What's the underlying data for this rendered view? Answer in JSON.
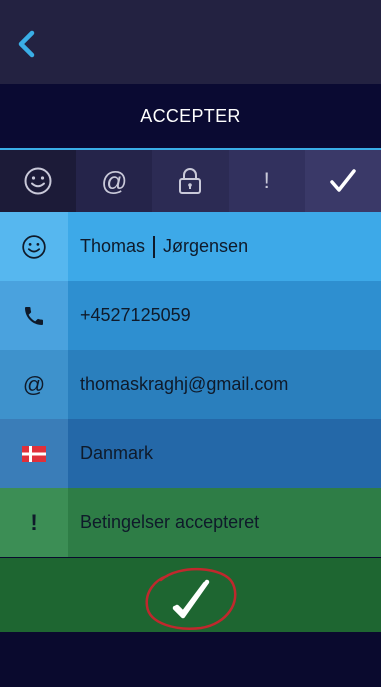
{
  "header": {
    "title": "ACCEPTER"
  },
  "tabs": [
    {
      "icon": "smiley-icon",
      "glyph": "☺"
    },
    {
      "icon": "at-icon",
      "glyph": "@"
    },
    {
      "icon": "lock-icon",
      "glyph": ""
    },
    {
      "icon": "exclamation-icon",
      "glyph": "!"
    },
    {
      "icon": "check-icon",
      "glyph": "✓"
    }
  ],
  "form": {
    "first_name": "Thomas",
    "last_name": "Jørgensen",
    "phone": "+4527125059",
    "email": "thomaskraghj@gmail.com",
    "country": "Danmark",
    "terms": "Betingelser accepteret"
  },
  "colors": {
    "accent": "#3aaee6",
    "confirm": "#1e6631",
    "annotation": "#c0282d"
  }
}
